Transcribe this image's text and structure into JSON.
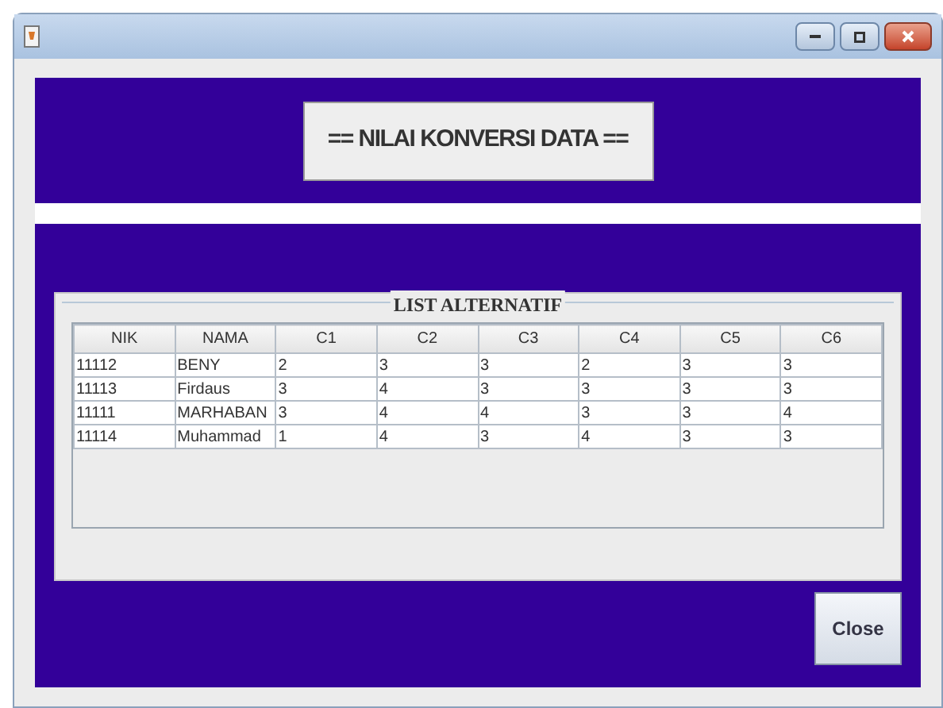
{
  "header": {
    "title": "== NILAI KONVERSI DATA =="
  },
  "panel": {
    "legend": "LIST ALTERNATIF"
  },
  "table": {
    "columns": [
      "NIK",
      "NAMA",
      "C1",
      "C2",
      "C3",
      "C4",
      "C5",
      "C6"
    ],
    "rows": [
      [
        "11112",
        "BENY",
        "2",
        "3",
        "3",
        "2",
        "3",
        "3"
      ],
      [
        "11113",
        "Firdaus",
        "3",
        "4",
        "3",
        "3",
        "3",
        "3"
      ],
      [
        "11111",
        "MARHABAN",
        "3",
        "4",
        "4",
        "3",
        "3",
        "4"
      ],
      [
        "11114",
        "Muhammad",
        "1",
        "4",
        "3",
        "4",
        "3",
        "3"
      ]
    ]
  },
  "close_button": "Close"
}
